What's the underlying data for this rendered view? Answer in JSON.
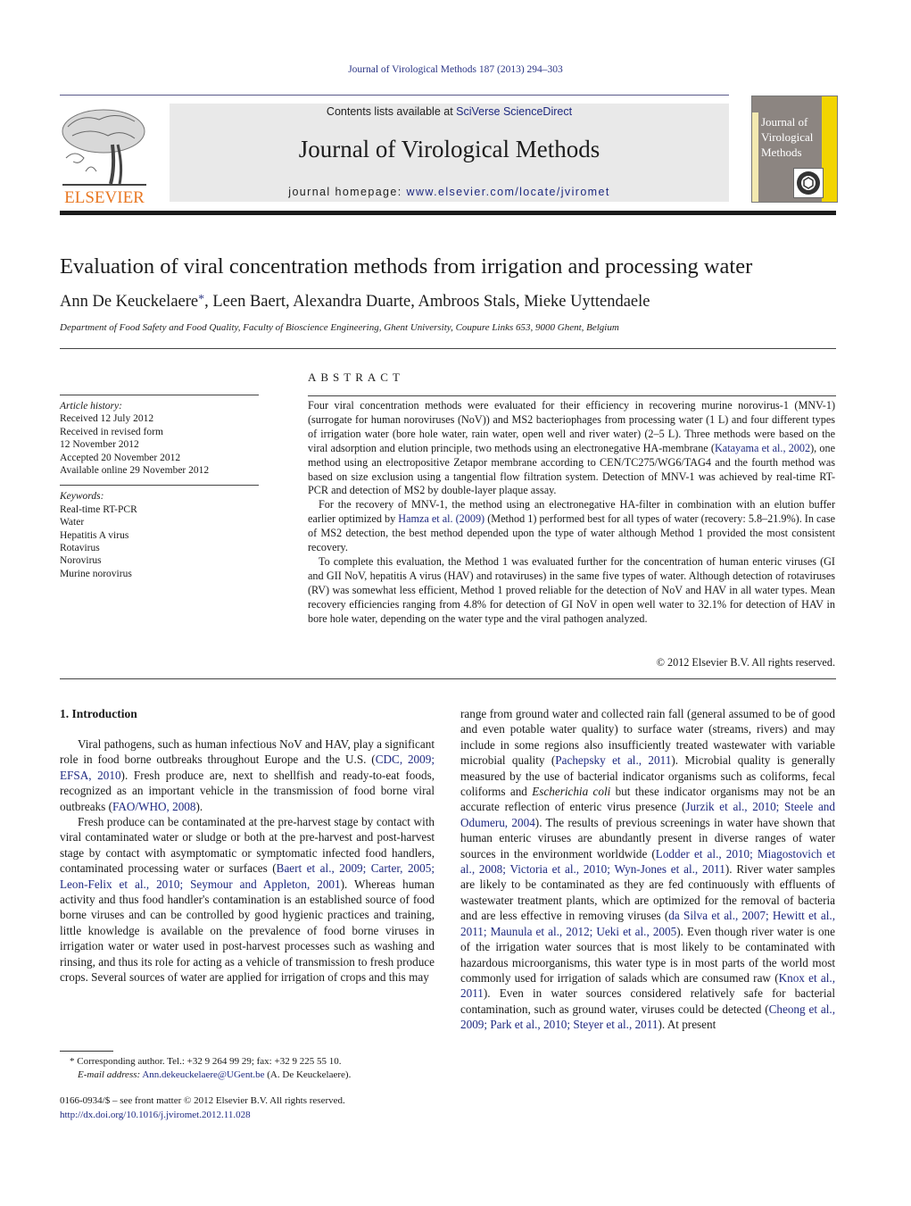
{
  "running_head": "Journal of Virological Methods 187 (2013) 294–303",
  "masthead": {
    "publisher_logo_text": "ELSEVIER",
    "contents_prefix": "Contents lists available at ",
    "contents_link": "SciVerse ScienceDirect",
    "journal_title": "Journal of Virological Methods",
    "homepage_prefix": "journal homepage: ",
    "homepage_link": "www.elsevier.com/locate/jviromet",
    "cover_title_lines": [
      "Journal of",
      "Virological",
      "Methods"
    ]
  },
  "article": {
    "title": "Evaluation of viral concentration methods from irrigation and processing water",
    "authors": [
      {
        "name": "Ann De Keuckelaere",
        "corresponding": true
      },
      {
        "name": "Leen Baert"
      },
      {
        "name": "Alexandra Duarte"
      },
      {
        "name": "Ambroos Stals"
      },
      {
        "name": "Mieke Uyttendaele"
      }
    ],
    "affiliation": "Department of Food Safety and Food Quality, Faculty of Bioscience Engineering, Ghent University, Coupure Links 653, 9000 Ghent, Belgium"
  },
  "article_info": {
    "history_label": "Article history:",
    "history": [
      "Received 12 July 2012",
      "Received in revised form",
      "12 November 2012",
      "Accepted 20 November 2012",
      "Available online 29 November 2012"
    ],
    "keywords_label": "Keywords:",
    "keywords": [
      "Real-time RT-PCR",
      "Water",
      "Hepatitis A virus",
      "Rotavirus",
      "Norovirus",
      "Murine norovirus"
    ]
  },
  "abstract": {
    "heading": "ABSTRACT",
    "p1_a": "Four viral concentration methods were evaluated for their efficiency in recovering murine norovirus-1 (MNV-1) (surrogate for human noroviruses (NoV)) and MS2 bacteriophages from processing water (1 L) and four different types of irrigation water (bore hole water, rain water, open well and river water) (2–5 L). Three methods were based on the viral adsorption and elution principle, two methods using an electronegative HA-membrane (",
    "p1_cite": "Katayama et al., 2002",
    "p1_b": "), one method using an electropositive Zetapor membrane according to CEN/TC275/WG6/TAG4 and the fourth method was based on size exclusion using a tangential flow filtration system. Detection of MNV-1 was achieved by real-time RT-PCR and detection of MS2 by double-layer plaque assay.",
    "p2_a": "For the recovery of MNV-1, the method using an electronegative HA-filter in combination with an elution buffer earlier optimized by ",
    "p2_cite": "Hamza et al. (2009)",
    "p2_b": " (Method 1) performed best for all types of water (recovery: 5.8–21.9%). In case of MS2 detection, the best method depended upon the type of water although Method 1 provided the most consistent recovery.",
    "p3": "To complete this evaluation, the Method 1 was evaluated further for the concentration of human enteric viruses (GI and GII NoV, hepatitis A virus (HAV) and rotaviruses) in the same five types of water. Although detection of rotaviruses (RV) was somewhat less efficient, Method 1 proved reliable for the detection of NoV and HAV in all water types. Mean recovery efficiencies ranging from 4.8% for detection of GI NoV in open well water to 32.1% for detection of HAV in bore hole water, depending on the water type and the viral pathogen analyzed.",
    "copyright": "© 2012 Elsevier B.V. All rights reserved."
  },
  "introduction": {
    "heading": "1.  Introduction",
    "left": {
      "p1_a": "Viral pathogens, such as human infectious NoV and HAV, play a significant role in food borne outbreaks throughout Europe and the U.S. (",
      "p1_cite1": "CDC, 2009; EFSA, 2010",
      "p1_b": "). Fresh produce are, next to shellfish and ready-to-eat foods, recognized as an important vehicle in the transmission of food borne viral outbreaks (",
      "p1_cite2": "FAO/WHO, 2008",
      "p1_c": ").",
      "p2_a": "Fresh produce can be contaminated at the pre-harvest stage by contact with viral contaminated water or sludge or both at the pre-harvest and post-harvest stage by contact with asymptomatic or symptomatic infected food handlers, contaminated processing water or surfaces (",
      "p2_cite": "Baert et al., 2009; Carter, 2005; Leon-Felix et al., 2010; Seymour and Appleton, 2001",
      "p2_b": "). Whereas human activity and thus food handler's contamination is an established source of food borne viruses and can be controlled by good hygienic practices and training, little knowledge is available on the prevalence of food borne viruses in irrigation water or water used in post-harvest processes such as washing and rinsing, and thus its role for acting as a vehicle of transmission to fresh produce crops. Several sources of water are applied for irrigation of crops and this may"
    },
    "right": {
      "a": "range from ground water and collected rain fall (general assumed to be of good and even potable water quality) to surface water (streams, rivers) and may include in some regions also insufficiently treated wastewater with variable microbial quality (",
      "cite1": "Pachepsky et al., 2011",
      "b": "). Microbial quality is generally measured by the use of bacterial indicator organisms such as coliforms, fecal coliforms and ",
      "italic": "Escherichia coli",
      "c": " but these indicator organisms may not be an accurate reflection of enteric virus presence (",
      "cite2": "Jurzik et al., 2010; Steele and Odumeru, 2004",
      "d": "). The results of previous screenings in water have shown that human enteric viruses are abundantly present in diverse ranges of water sources in the environment worldwide (",
      "cite3": "Lodder et al., 2010; Miagostovich et al., 2008; Victoria et al., 2010; Wyn-Jones et al., 2011",
      "e": "). River water samples are likely to be contaminated as they are fed continuously with effluents of wastewater treatment plants, which are optimized for the removal of bacteria and are less effective in removing viruses (",
      "cite4": "da Silva et al., 2007; Hewitt et al., 2011; Maunula et al., 2012; Ueki et al., 2005",
      "f": "). Even though river water is one of the irrigation water sources that is most likely to be contaminated with hazardous microorganisms, this water type is in most parts of the world most commonly used for irrigation of salads which are consumed raw (",
      "cite5": "Knox et al., 2011",
      "g": "). Even in water sources considered relatively safe for bacterial contamination, such as ground water, viruses could be detected (",
      "cite6": "Cheong et al., 2009; Park et al., 2010; Steyer et al., 2011",
      "h": "). At present"
    }
  },
  "footnote": {
    "star": "*",
    "corresponding": "Corresponding author. Tel.: +32 9 264 99 29; fax: +32 9 225 55 10.",
    "email_label": "E-mail address:",
    "email": "Ann.dekeuckelaere@UGent.be",
    "email_suffix": " (A. De Keuckelaere)."
  },
  "front_matter": {
    "issn_line": "0166-0934/$ – see front matter © 2012 Elsevier B.V. All rights reserved.",
    "doi": "http://dx.doi.org/10.1016/j.jviromet.2012.11.028"
  },
  "colors": {
    "link": "#1f2a80",
    "elsevier_orange": "#e87722",
    "banner_gray": "#e9e9e9",
    "cover_yellow": "#f2d400"
  }
}
